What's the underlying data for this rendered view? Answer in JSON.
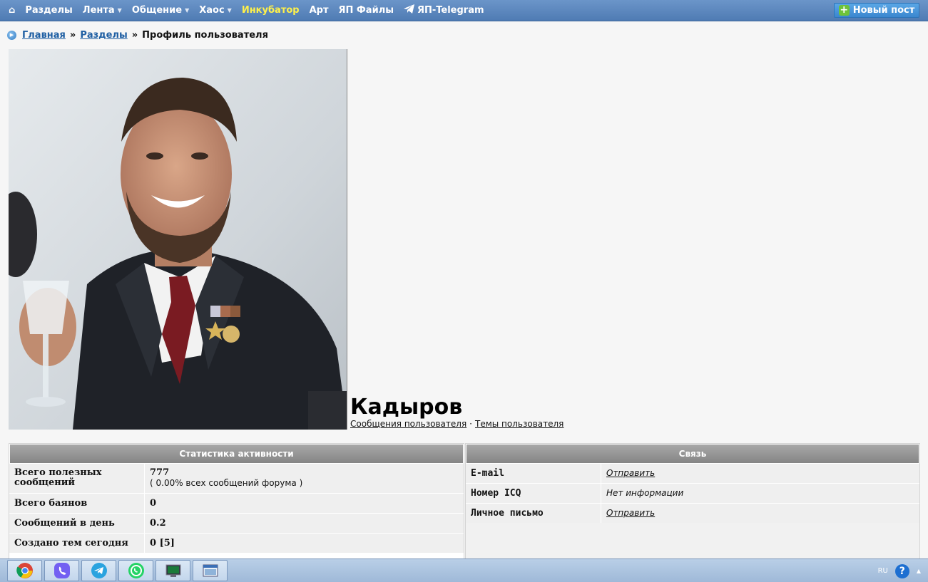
{
  "nav": {
    "items": [
      {
        "label": "Разделы",
        "dropdown": false
      },
      {
        "label": "Лента",
        "dropdown": true
      },
      {
        "label": "Общение",
        "dropdown": true
      },
      {
        "label": "Хаос",
        "dropdown": true
      },
      {
        "label": "Инкубатор",
        "dropdown": false,
        "accent": true
      },
      {
        "label": "Арт",
        "dropdown": false
      },
      {
        "label": "ЯП Файлы",
        "dropdown": false
      },
      {
        "label": "ЯП-Telegram",
        "dropdown": false,
        "icon": "telegram-icon"
      }
    ],
    "new_post": "Новый пост",
    "colors": {
      "bar": "#5a86bf",
      "accent_text": "#fff14a",
      "new_post": "#3b87cf"
    }
  },
  "breadcrumb": {
    "home": "Главная",
    "sections": "Разделы",
    "current": "Профиль пользователя",
    "separator": "»"
  },
  "profile": {
    "name": "Кадыров",
    "messages_link": "Сообщения пользователя",
    "topics_link": "Темы пользователя",
    "links_separator": "·"
  },
  "stats": {
    "title": "Статистика активности",
    "rows": [
      {
        "label": "Всего полезных сообщений",
        "value": "777",
        "sub": "( 0.00% всех сообщений форума )"
      },
      {
        "label": "Всего баянов",
        "value": "0"
      },
      {
        "label": "Сообщений в день",
        "value": "0.2"
      },
      {
        "label": "Создано тем сегодня",
        "value": "0 [5]"
      }
    ]
  },
  "contact": {
    "title": "Связь",
    "rows": [
      {
        "label": "E-mail",
        "value": "Отправить",
        "link": true
      },
      {
        "label": "Номер ICQ",
        "value": "Нет информации",
        "link": false
      },
      {
        "label": "Личное письмо",
        "value": "Отправить",
        "link": true
      }
    ]
  },
  "taskbar": {
    "apps": [
      "chrome-icon",
      "viber-icon",
      "telegram-icon",
      "whatsapp-icon",
      "terminal-icon",
      "window-icon"
    ],
    "lang": "RU"
  }
}
